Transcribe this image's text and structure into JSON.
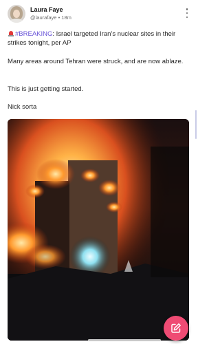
{
  "author": {
    "display_name": "Laura Faye",
    "handle": "@laurafaye",
    "separator": "•",
    "timestamp": "18m"
  },
  "post": {
    "hashtag": "#BREAKING",
    "line1_rest": ": Israel targeted Iran’s nuclear sites in their strikes tonight, per AP",
    "paragraph2": "Many areas around Tehran were struck, and are now ablaze.",
    "paragraph3": "This is just getting started.",
    "paragraph4": "Nick sorta"
  },
  "icons": {
    "siren": "police-car-light-emoji",
    "menu": "more-vertical-icon",
    "compose": "edit-square-icon"
  },
  "colors": {
    "hashtag": "#6a55d8",
    "compose_button": "#ef4b74",
    "scroll_thumb": "#c9cbe7"
  }
}
